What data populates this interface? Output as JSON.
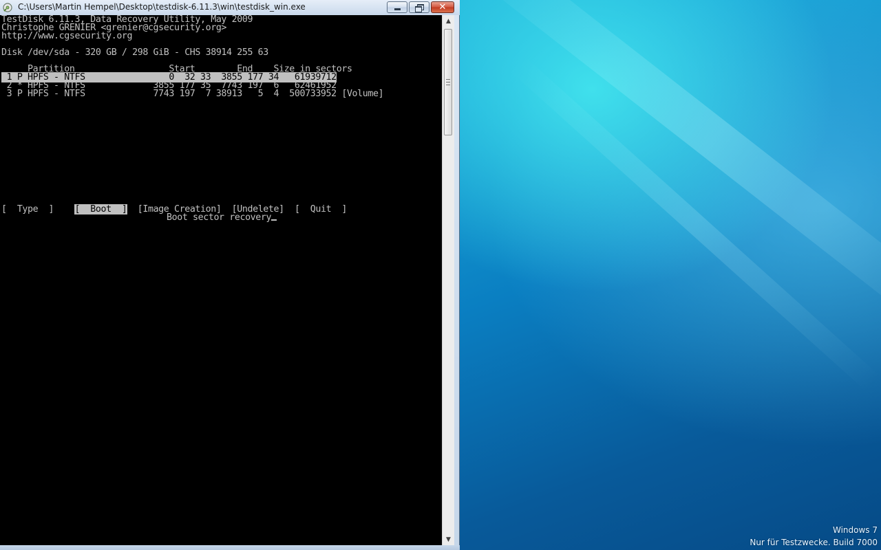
{
  "window": {
    "title": "C:\\Users\\Martin Hempel\\Desktop\\testdisk-6.11.3\\win\\testdisk_win.exe",
    "close_glyph": "✕",
    "icon": "testdisk-app-icon"
  },
  "console": {
    "header_line1": "TestDisk 6.11.3, Data Recovery Utility, May 2009",
    "header_line2": "Christophe GRENIER <grenier@cgsecurity.org>",
    "header_line3": "http://www.cgsecurity.org",
    "disk_info": "Disk /dev/sda - 320 GB / 298 GiB - CHS 38914 255 63",
    "table_header": "     Partition                  Start        End    Size in sectors",
    "partitions": [
      {
        "line": " 1 P HPFS - NTFS                0  32 33  3855 177 34   61939712",
        "selected": true
      },
      {
        "line": " 2 * HPFS - NTFS             3855 177 35  7743 197  6   62461952",
        "selected": false
      },
      {
        "line": " 3 P HPFS - NTFS             7743 197  7 38913   5  4  500733952 [Volume]",
        "selected": false
      }
    ],
    "menu": {
      "type_label": "[  Type  ]",
      "boot_label": "[  Boot  ]",
      "image_creation_label": "[Image Creation]",
      "undelete_label": "[Undelete]",
      "quit_label": "[  Quit  ]"
    },
    "status_text": "Boot sector recovery"
  },
  "desktop": {
    "watermark_line1": "Windows 7",
    "watermark_line2": "Nur für Testzwecke. Build 7000"
  },
  "colors": {
    "console_bg": "#000000",
    "console_text": "#c0c0c0",
    "highlight_bg": "#c0c0c0",
    "close_button": "#c23b22"
  }
}
